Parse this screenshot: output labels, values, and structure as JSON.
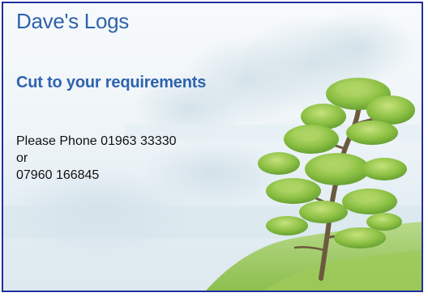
{
  "card": {
    "title": "Dave's Logs",
    "tagline": "Cut to your requirements",
    "contact_lines": [
      "Please Phone 01963 33330",
      "or",
      "07960 166845"
    ]
  },
  "colors": {
    "border": "#1f2fa0",
    "heading_blue": "#2e63ad",
    "text": "#111111",
    "foliage": "#7fb83f",
    "sky": "#eef4f8"
  },
  "icons": {
    "illustration": "watercolour-tree-landscape"
  }
}
